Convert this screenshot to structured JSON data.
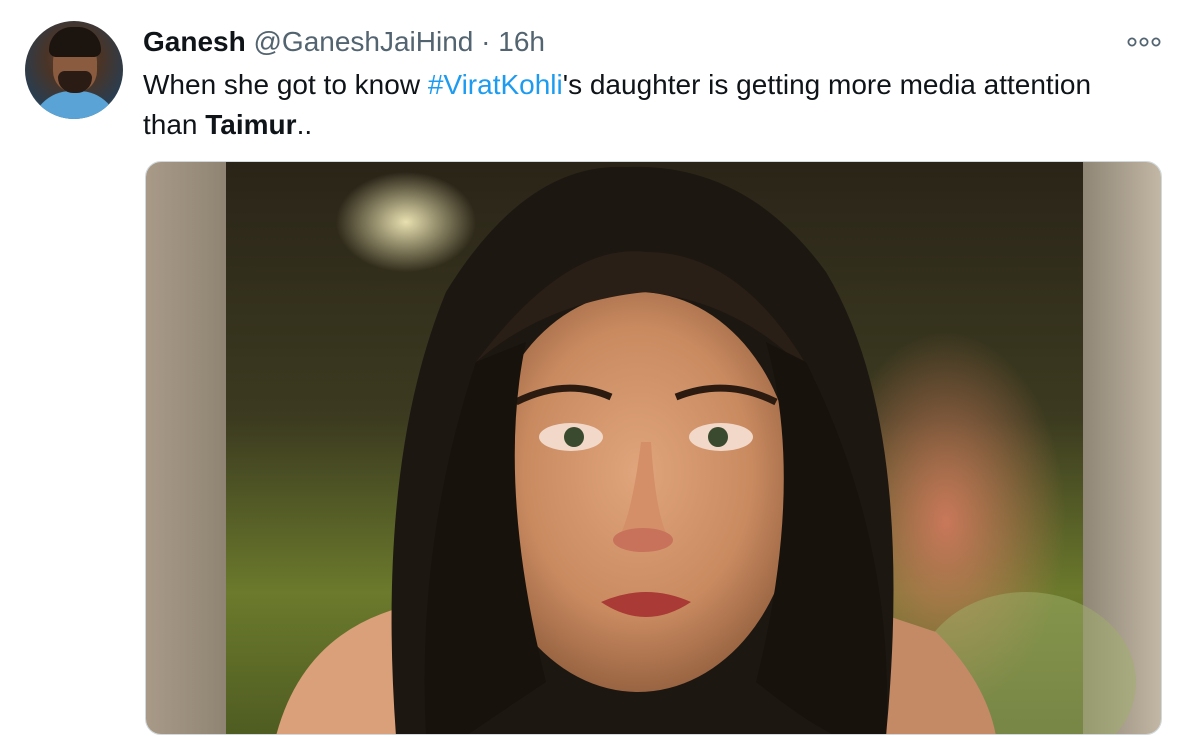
{
  "tweet": {
    "author_name": "Ganesh",
    "author_handle": "@GaneshJaiHind",
    "separator": "·",
    "time": "16h",
    "text_part1": "When she got to know ",
    "hashtag": "#ViratKohli",
    "text_part2": "'s daughter is getting more media attention than ",
    "bold_word": "Taimur",
    "text_part3": ".."
  },
  "icons": {
    "more": "more-options-icon",
    "avatar": "avatar"
  },
  "colors": {
    "text": "#0f1419",
    "secondary": "#536471",
    "link": "#1d9bf0",
    "border": "#cfd9de"
  }
}
